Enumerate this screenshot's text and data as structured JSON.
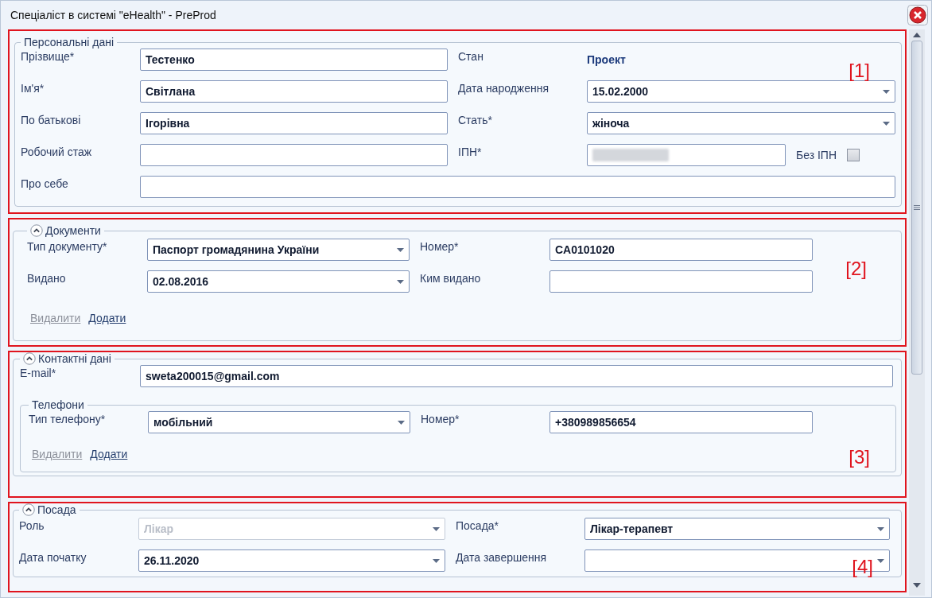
{
  "window": {
    "title": "Спеціаліст в системі \"eHealth\" - PreProd"
  },
  "sections": [
    {
      "marker": "[1]",
      "legend": "Персональні дані",
      "collapsible": false,
      "rows": [
        {
          "fields": [
            {
              "label": "Прізвище*",
              "kind": "text",
              "value": "Тестенко"
            },
            {
              "label": "Стан",
              "kind": "status",
              "value": "Проект"
            }
          ]
        },
        {
          "fields": [
            {
              "label": "Ім'я*",
              "kind": "text",
              "value": "Світлана"
            },
            {
              "label": "Дата народження",
              "kind": "combo",
              "value": "15.02.2000",
              "disabled": false
            }
          ]
        },
        {
          "fields": [
            {
              "label": "По батькові",
              "kind": "text",
              "value": "Ігорівна"
            },
            {
              "label": "Стать*",
              "kind": "combo",
              "value": "жіноча",
              "disabled": false
            }
          ]
        },
        {
          "fields": [
            {
              "label": "Робочий стаж",
              "kind": "text"
            },
            {
              "label": "ІПН*",
              "kind": "redacted",
              "checkbox": {
                "label": "Без ІПН",
                "checked": false
              }
            }
          ]
        },
        {
          "fields": [
            {
              "label": "Про себе",
              "kind": "text"
            }
          ]
        }
      ]
    },
    {
      "marker": "[2]",
      "legend": "Документи",
      "collapsible": true,
      "rows": [
        {
          "fields": [
            {
              "label": "Тип документу*",
              "kind": "combo",
              "value": "Паспорт громадянина України",
              "disabled": false
            },
            {
              "label": "Номер*",
              "kind": "text",
              "value": "CA0101020"
            }
          ]
        },
        {
          "fields": [
            {
              "label": "Видано",
              "kind": "combo",
              "value": "02.08.2016",
              "disabled": false
            },
            {
              "label": "Ким видано",
              "kind": "text"
            }
          ]
        }
      ],
      "links": [
        {
          "label": "Видалити",
          "disabled": true
        },
        {
          "label": "Додати",
          "disabled": false
        }
      ]
    },
    {
      "marker": "[3]",
      "legend": "Контактні дані",
      "collapsible": true,
      "rows": [
        {
          "fields": [
            {
              "label": "E-mail*",
              "kind": "text",
              "value": "sweta200015@gmail.com"
            }
          ]
        }
      ],
      "group": {
        "legend": "Телефони",
        "rows": [
          {
            "fields": [
              {
                "label": "Тип телефону*",
                "kind": "combo",
                "value": "мобільний",
                "disabled": false
              },
              {
                "label": "Номер*",
                "kind": "text",
                "value": "+380989856654"
              }
            ]
          }
        ],
        "links": [
          {
            "label": "Видалити",
            "disabled": true
          },
          {
            "label": "Додати",
            "disabled": false
          }
        ]
      }
    },
    {
      "marker": "[4]",
      "legend": "Посада",
      "collapsible": true,
      "rows": [
        {
          "fields": [
            {
              "label": "Роль",
              "kind": "combo",
              "value": "Лікар",
              "disabled": true
            },
            {
              "label": "Посада*",
              "kind": "combo",
              "value": "Лікар-терапевт",
              "disabled": false
            }
          ]
        },
        {
          "fields": [
            {
              "label": "Дата початку",
              "kind": "combo",
              "value": "26.11.2020",
              "disabled": false
            },
            {
              "label": "Дата завершення",
              "kind": "combo",
              "disabled": false
            }
          ]
        }
      ]
    }
  ]
}
